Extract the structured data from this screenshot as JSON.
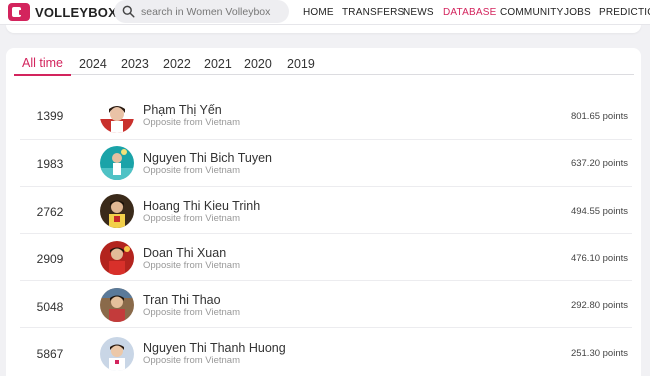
{
  "header": {
    "logo_text": "VOLLEYBOX",
    "search_placeholder": "search in Women Volleybox",
    "nav": [
      "HOME",
      "TRANSFERS",
      "NEWS",
      "DATABASE",
      "COMMUNITY",
      "JOBS",
      "PREDICTIONS"
    ],
    "active_nav": "DATABASE",
    "accent_color": "#d3245d"
  },
  "tabs": [
    "All time",
    "2024",
    "2023",
    "2022",
    "2021",
    "2020",
    "2019"
  ],
  "active_tab": "All time",
  "players": [
    {
      "rank": "1399",
      "name": "Phạm Thị Yến",
      "subtitle": "Opposite from Vietnam",
      "points": "801.65 points",
      "avatar_color": "#c9302c"
    },
    {
      "rank": "1983",
      "name": "Nguyen Thi Bich Tuyen",
      "subtitle": "Opposite from Vietnam",
      "points": "637.20 points",
      "avatar_color": "#1aa3a8"
    },
    {
      "rank": "2762",
      "name": "Hoang Thi Kieu Trinh",
      "subtitle": "Opposite from Vietnam",
      "points": "494.55 points",
      "avatar_color": "#3a2a1a"
    },
    {
      "rank": "2909",
      "name": "Doan Thi Xuan",
      "subtitle": "Opposite from Vietnam",
      "points": "476.10 points",
      "avatar_color": "#b3241e"
    },
    {
      "rank": "5048",
      "name": "Tran Thi Thao",
      "subtitle": "Opposite from Vietnam",
      "points": "292.80 points",
      "avatar_color": "#8a6a4a"
    },
    {
      "rank": "5867",
      "name": "Nguyen Thi Thanh Huong",
      "subtitle": "Opposite from Vietnam",
      "points": "251.30 points",
      "avatar_color": "#c9d6e6"
    }
  ]
}
